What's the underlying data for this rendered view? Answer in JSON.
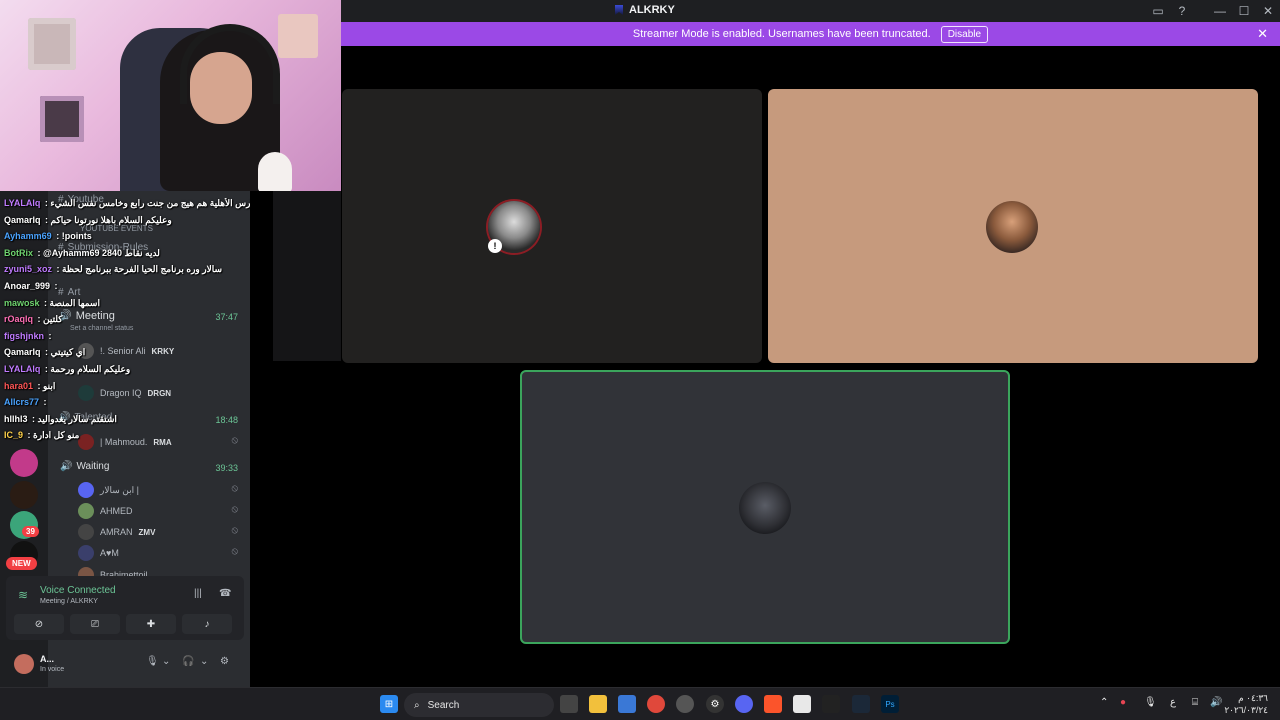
{
  "window": {
    "title": "ALKRKY"
  },
  "banner": {
    "text": "Streamer Mode is enabled. Usernames have been truncated.",
    "button": "Disable"
  },
  "sidebar": {
    "channels": [
      {
        "label": "Youtube"
      },
      {
        "label": "YOUTUBE EVENTS"
      },
      {
        "label": "Submission-Rules"
      },
      {
        "label": "Art"
      }
    ],
    "voice_channels": [
      {
        "label": "Meeting",
        "time": "37:47",
        "status": "Set a channel status"
      },
      {
        "label": "Talented",
        "time": "18:48"
      },
      {
        "label": "Waiting",
        "time": "39:33"
      }
    ],
    "members": [
      {
        "name": "!. Senior Ali",
        "tag": "KRKY"
      },
      {
        "name": "Dragon IQ",
        "tag": "DRGN"
      },
      {
        "name": "| Mahmoud.",
        "tag": "RMA"
      },
      {
        "name": "ابن سالار |",
        "tag": ""
      },
      {
        "name": "AHMED",
        "tag": ""
      },
      {
        "name": "AMRAN",
        "tag": "ZMV"
      },
      {
        "name": "A♥M",
        "tag": ""
      },
      {
        "name": "Brahimettoil",
        "tag": ""
      }
    ],
    "server_badges": {
      "count": "39",
      "new": "NEW"
    }
  },
  "chat": [
    {
      "user": "LYALAlq",
      "msg": "المدارس الأهلية هم هيج من جنت رابع وخامس نفس الشيء",
      "color": "#c07bff"
    },
    {
      "user": "Qamarlq",
      "msg": "وعليكم السلام باهلا نورتونا حياكم",
      "color": "#ffffff"
    },
    {
      "user": "Ayhamm69",
      "msg": "!points",
      "color": "#4aa3ff"
    },
    {
      "user": "BotRix",
      "msg": "@Ayhamm69 لديه نقاط 2840",
      "color": "#6fd36f"
    },
    {
      "user": "zyuni5_xoz",
      "msg": "سالار وره برنامج الحيا الفرحة ببرنامج لحظة",
      "color": "#c07bff"
    },
    {
      "user": "Anoar_999",
      "msg": "",
      "color": "#ffffff"
    },
    {
      "user": "mawosk",
      "msg": "اسمها المنصة",
      "color": "#6fd36f"
    },
    {
      "user": "rOaqlq",
      "msg": "كلتين",
      "color": "#ff6fb5"
    },
    {
      "user": "figshjnkn",
      "msg": "",
      "color": "#c07bff"
    },
    {
      "user": "Qamarlq",
      "msg": "اي كيتيتي",
      "color": "#ffffff"
    },
    {
      "user": "LYALAlq",
      "msg": "وعليكم السلام ورحمة",
      "color": "#c07bff"
    },
    {
      "user": "hara01",
      "msg": "ابنو",
      "color": "#ff5555"
    },
    {
      "user": "Allcrs77",
      "msg": "",
      "color": "#4aa3ff"
    },
    {
      "user": "hllhl3",
      "msg": "اشتقتم سالار يغدواليد",
      "color": "#ffffff"
    },
    {
      "user": "IC_9",
      "msg": "منو كل ادارة",
      "color": "#ffd24a"
    }
  ],
  "voice_panel": {
    "title": "Voice Connected",
    "subtitle": "Meeting / ALKRKY"
  },
  "user": {
    "name": "A...",
    "status": "In voice"
  },
  "taskbar": {
    "search_placeholder": "Search"
  },
  "clock": {
    "time": "٠٤:٣٦ م",
    "date": "٢٠٢٦/٠٣/٢٤"
  },
  "tray_lang": "ع",
  "colors": {
    "banner": "#9b49e6",
    "accent_green": "#3ba55c",
    "sidebar": "#2b2d31"
  }
}
